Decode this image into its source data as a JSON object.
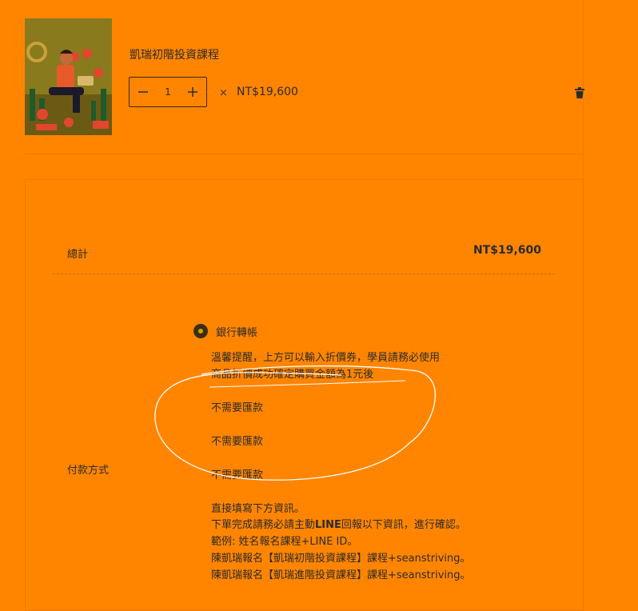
{
  "cart": {
    "product": {
      "title": "凱瑞初階投資課程",
      "quantity": "1",
      "times_symbol": "×",
      "price": "NT$19,600"
    }
  },
  "summary": {
    "total_label": "總計",
    "total_value": "NT$19,600",
    "payment_label": "付款方式",
    "payment_option": "銀行轉帳",
    "notice_line1": "溫馨提醒，上方可以輸入折價券，學員請務必使用",
    "notice_line2": "商品折價成功確定購買金額為1元後",
    "no_remit_1": "不需要匯款",
    "no_remit_2": "不需要匯款",
    "no_remit_3": "不需要匯款",
    "instr_line1": "直接填寫下方資訊。",
    "instr_line2_a": "下單完成請務必請主動",
    "instr_line2_b": "LINE",
    "instr_line2_c": "回報以下資訊，進行確認。",
    "instr_line3": "範例: 姓名報名課程+LINE ID。",
    "instr_line4": "陳凱瑞報名【凱瑞初階投資課程】課程+seanstriving。",
    "instr_line5": "陳凱瑞報名【凱瑞進階投資課程】課程+seanstriving。"
  },
  "colors": {
    "background": "#FF8500",
    "text": "#2b2b2b",
    "radio": "#3a2f10"
  }
}
